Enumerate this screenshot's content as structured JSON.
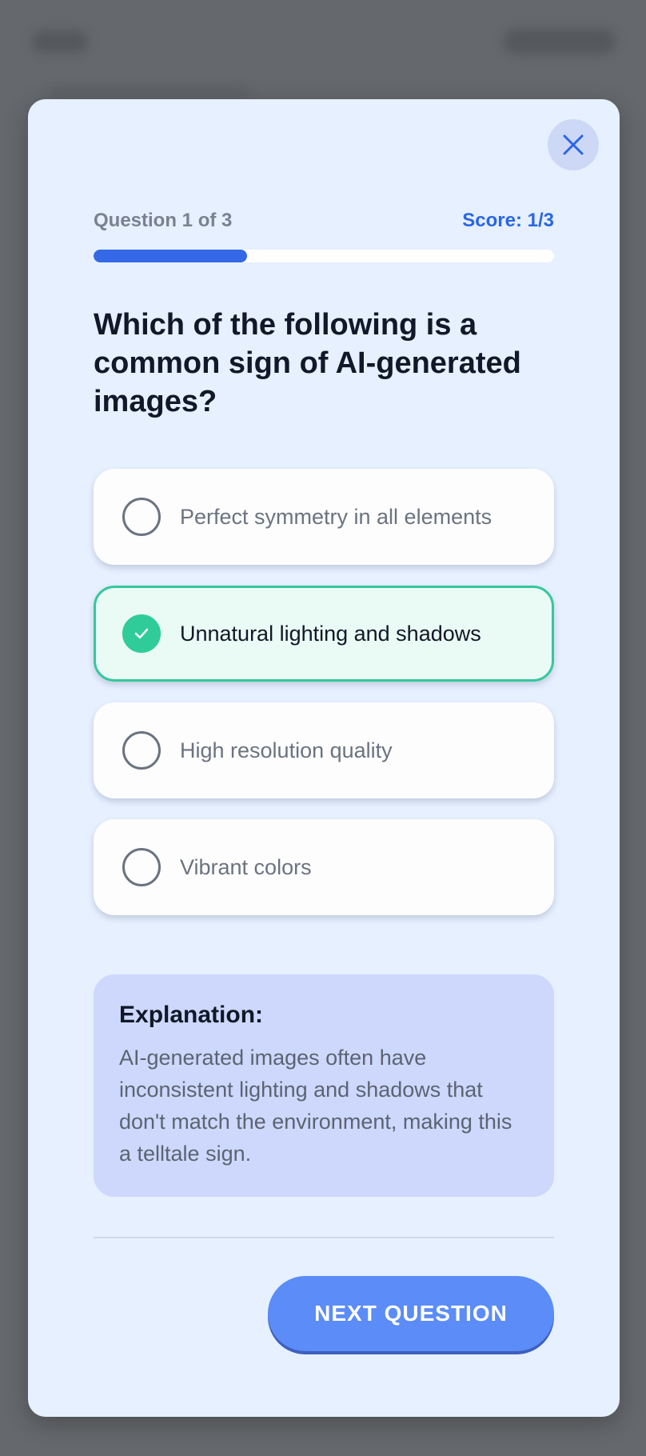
{
  "quiz": {
    "question_counter": "Question 1 of 3",
    "score": "Score: 1/3",
    "progress": 0.333,
    "question": "Which of the following is a common sign of AI-generated images?",
    "options": [
      {
        "label": "Perfect symmetry in all elements",
        "selected": false
      },
      {
        "label": "Unnatural lighting and shadows",
        "selected": true
      },
      {
        "label": "High resolution quality",
        "selected": false
      },
      {
        "label": "Vibrant colors",
        "selected": false
      }
    ],
    "explanation": {
      "title": "Explanation:",
      "text": "AI-generated images often have inconsistent lighting and shadows that don't match the environment, making this a telltale sign."
    },
    "next_button": "NEXT QUESTION"
  },
  "icons": {
    "close": "close-icon",
    "check": "check-icon"
  },
  "colors": {
    "accent": "#2a66e6",
    "progress": "#3468e6",
    "correct": "#2fcc9a",
    "button": "#5b8cf7",
    "modal_bg": "#e6f0ff",
    "explanation_bg": "#cdd8fc"
  }
}
